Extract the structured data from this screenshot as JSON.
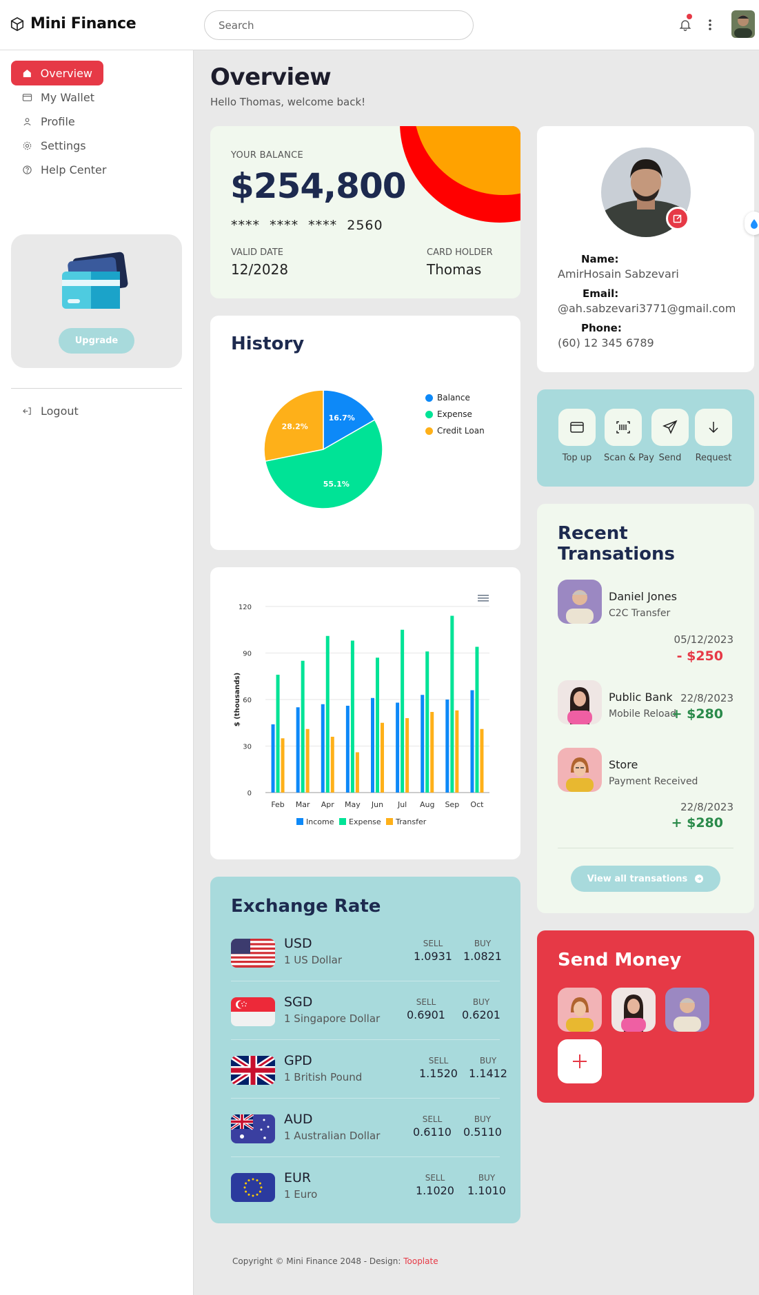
{
  "brand": {
    "name": "Mini Finance"
  },
  "header": {
    "search_placeholder": "Search"
  },
  "sidebar": {
    "items": [
      {
        "label": "Overview",
        "icon": "home-icon",
        "active": true
      },
      {
        "label": "My Wallet",
        "icon": "wallet-icon"
      },
      {
        "label": "Profile",
        "icon": "person-icon"
      },
      {
        "label": "Settings",
        "icon": "gear-icon"
      },
      {
        "label": "Help Center",
        "icon": "question-icon"
      }
    ],
    "upgrade_label": "Upgrade",
    "logout_label": "Logout"
  },
  "page": {
    "title": "Overview",
    "subtitle": "Hello Thomas, welcome back!"
  },
  "balance": {
    "label": "YOUR BALANCE",
    "amount": "$254,800",
    "card_number": "****  ****  ****  2560",
    "valid_label": "VALID DATE",
    "valid_value": "12/2028",
    "holder_label": "CARD HOLDER",
    "holder_value": "Thomas"
  },
  "history": {
    "title": "History",
    "chart_data": {
      "type": "pie",
      "labels": [
        "Balance",
        "Expense",
        "Credit Loan"
      ],
      "values": [
        16.7,
        55.1,
        28.2
      ],
      "value_labels": [
        "16.7%",
        "55.1%",
        "28.2%"
      ],
      "colors": [
        "#0d89f8",
        "#00e396",
        "#feb019"
      ],
      "legend": "right"
    }
  },
  "bar_chart": {
    "chart_data": {
      "type": "bar",
      "categories": [
        "Feb",
        "Mar",
        "Apr",
        "May",
        "Jun",
        "Jul",
        "Aug",
        "Sep",
        "Oct"
      ],
      "series": [
        {
          "name": "Income",
          "values": [
            44,
            55,
            57,
            56,
            61,
            58,
            63,
            60,
            66
          ],
          "color": "#0d89f8"
        },
        {
          "name": "Expense",
          "values": [
            76,
            85,
            101,
            98,
            87,
            105,
            91,
            114,
            94
          ],
          "color": "#00e396"
        },
        {
          "name": "Transfer",
          "values": [
            35,
            41,
            36,
            26,
            45,
            48,
            52,
            53,
            41
          ],
          "color": "#feb019"
        }
      ],
      "ylabel": "$ (thousands)",
      "yticks": [
        "0",
        "30",
        "60",
        "90",
        "120"
      ],
      "ylim": [
        0,
        120
      ],
      "grid": true,
      "legend": "bottom"
    }
  },
  "exchange": {
    "title": "Exchange Rate",
    "sell_label": "SELL",
    "buy_label": "BUY",
    "rows": [
      {
        "code": "USD",
        "name": "1 US Dollar",
        "sell": "1.0931",
        "buy": "1.0821",
        "flag": "us-flag-icon"
      },
      {
        "code": "SGD",
        "name": "1 Singapore Dollar",
        "sell": "0.6901",
        "buy": "0.6201",
        "flag": "sg-flag-icon"
      },
      {
        "code": "GPD",
        "name": "1 British Pound",
        "sell": "1.1520",
        "buy": "1.1412",
        "flag": "gb-flag-icon"
      },
      {
        "code": "AUD",
        "name": "1 Australian Dollar",
        "sell": "0.6110",
        "buy": "0.5110",
        "flag": "au-flag-icon"
      },
      {
        "code": "EUR",
        "name": "1 Euro",
        "sell": "1.1020",
        "buy": "1.1010",
        "flag": "eu-flag-icon"
      }
    ]
  },
  "profile": {
    "name_label": "Name:",
    "name_value": "AmirHosain Sabzevari",
    "email_label": "Email:",
    "email_value": "@ah.sabzevari3771@gmail.com",
    "phone_label": "Phone:",
    "phone_value": "(60) 12 345 6789"
  },
  "actions": [
    {
      "label": "Top up",
      "icon": "wallet-icon"
    },
    {
      "label": "Scan & Pay",
      "icon": "barcode-icon"
    },
    {
      "label": "Send",
      "icon": "send-icon"
    },
    {
      "label": "Request",
      "icon": "arrow-down-icon"
    }
  ],
  "transactions": {
    "title_line1": "Recent",
    "title_line2": "Transations",
    "items": [
      {
        "name": "Daniel Jones",
        "sub": "C2C Transfer",
        "date": "05/12/2023",
        "amount": "- $250",
        "color": "#e63946"
      },
      {
        "name": "Public Bank",
        "sub": "Mobile Reload",
        "date": "22/8/2023",
        "amount": "+ $280",
        "color": "#2a8a4a"
      },
      {
        "name": "Store",
        "sub": "Payment Received",
        "date": "22/8/2023",
        "amount": "+ $280",
        "color": "#2a8a4a"
      }
    ],
    "view_all_label": "View all transations"
  },
  "send_money": {
    "title": "Send Money"
  },
  "footer": {
    "text": "Copyright © Mini Finance 2048 - Design: ",
    "link": "Tooplate"
  },
  "colors": {
    "accent": "#e63946",
    "teal": "#a8dadc",
    "navy": "#1d2a4f",
    "mint": "#f1f8ee"
  }
}
